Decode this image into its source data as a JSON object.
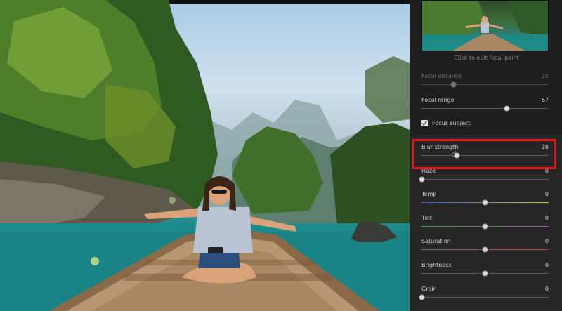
{
  "panel": {
    "preview_caption": "Click to edit focal point",
    "focal_distance": {
      "label": "Focal distance",
      "value": "25",
      "level": 0.25
    },
    "focal_range": {
      "label": "Focal range",
      "value": "67",
      "level": 0.67
    },
    "focus_subject": {
      "label": "Focus subject",
      "checked": true
    },
    "sliders": [
      {
        "label": "Blur strength",
        "value": "28",
        "level": 0.28,
        "track_color": "#5a5a5a"
      },
      {
        "label": "Haze",
        "value": "0",
        "level": 0.0,
        "track_color": "#5a5a5a"
      },
      {
        "label": "Temp",
        "value": "0",
        "level": 0.5,
        "track": "gradient-blue-yellow"
      },
      {
        "label": "Tint",
        "value": "0",
        "level": 0.5,
        "track": "gradient-green-magenta"
      },
      {
        "label": "Saturation",
        "value": "0",
        "level": 0.5,
        "track": "gradient-gray-red"
      },
      {
        "label": "Brightness",
        "value": "0",
        "level": 0.5,
        "track_color": "#5a5a5a"
      },
      {
        "label": "Grain",
        "value": "0",
        "level": 0.0,
        "track_color": "#5a5a5a"
      }
    ]
  },
  "colors": {
    "highlight": "#e8141a",
    "panel_bg": "#262626"
  }
}
